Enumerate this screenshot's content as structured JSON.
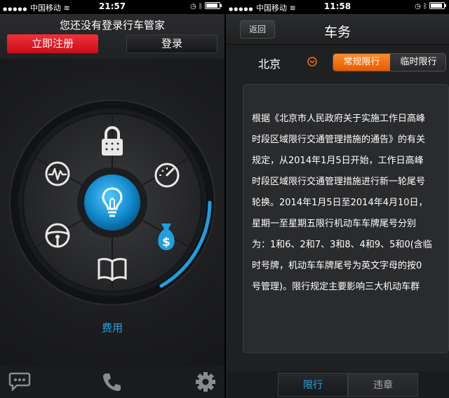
{
  "left_screen": {
    "status_bar": {
      "carrier": "中国移动",
      "time": "21:57"
    },
    "header": {
      "prompt": "您还没有登录行车管家",
      "register_button": "立即注册",
      "login_button": "登录"
    },
    "wheel": {
      "segments": [
        "lock-icon",
        "gauge-icon",
        "money-bag-icon",
        "book-icon",
        "steering-wheel-icon",
        "pulse-icon"
      ],
      "center_icon": "lightbulb-icon",
      "selected_label": "费用",
      "accent_color": "#21a8e6"
    },
    "toolbar": [
      "chat-icon",
      "phone-icon",
      "gear-icon"
    ]
  },
  "right_screen": {
    "status_bar": {
      "carrier": "中国移动",
      "time": "11:58"
    },
    "nav": {
      "back": "返回",
      "title": "车务"
    },
    "city": "北京",
    "segmented": {
      "active": "常规限行",
      "inactive": "临时限行",
      "active_color": "#f07418"
    },
    "notice": "根据《北京市人民政府关于实施工作日高峰\n时段区域限行交通管理措施的通告》的有关\n规定，从2014年1月5日开始，工作日高峰\n时段区域限行交通管理措施进行新一轮尾号\n轮换。2014年1月5日至2014年4月10日，\n星期一至星期五限行机动车车牌尾号分别\n为：1和6、2和7、3和8、4和9、5和0(含临\n时号牌，机动车车牌尾号为英文字母的按0\n号管理)。限行规定主要影响三大机动车群",
    "tabs": {
      "active": "限行",
      "inactive": "违章"
    }
  }
}
